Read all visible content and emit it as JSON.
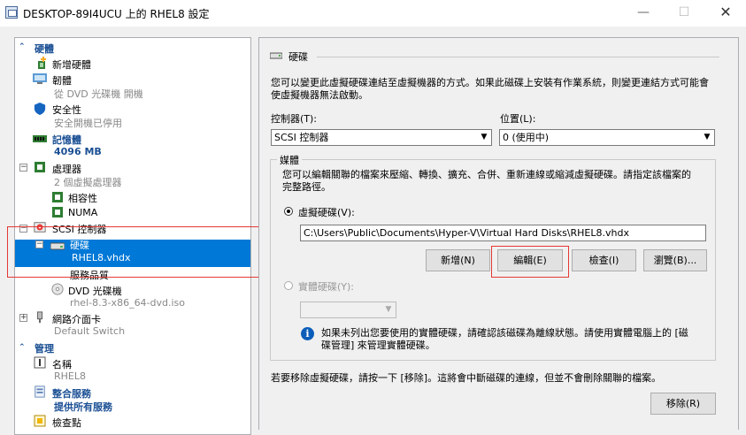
{
  "window": {
    "title": "DESKTOP-89I4UCU 上的 RHEL8 設定",
    "min_glyph": "—",
    "max_glyph": "☐",
    "close_glyph": "✕"
  },
  "tree": {
    "hardware_header": "硬體",
    "add_hardware": "新增硬體",
    "firmware": "韌體",
    "firmware_sub": "從 DVD 光碟機 開機",
    "security": "安全性",
    "security_sub": "安全開機已停用",
    "memory": "記憶體",
    "memory_sub": "4096 MB",
    "processor": "處理器",
    "processor_sub": "2 個虛擬處理器",
    "compatibility": "相容性",
    "numa": "NUMA",
    "scsi": "SCSI 控制器",
    "hard_drive": "硬碟",
    "hard_drive_sub": "RHEL8.vhdx",
    "qos": "服務品質",
    "dvd": "DVD 光碟機",
    "dvd_sub": "rhel-8.3-x86_64-dvd.iso",
    "nic": "網路介面卡",
    "nic_sub": "Default Switch",
    "management_header": "管理",
    "name": "名稱",
    "name_sub": "RHEL8",
    "integration": "整合服務",
    "integration_sub": "提供所有服務",
    "checkpoint": "檢查點"
  },
  "panel": {
    "title": "硬碟",
    "description": "您可以變更此虛擬硬碟連結至虛擬機器的方式。如果此磁碟上安裝有作業系統，則變更連結方式可能會使虛擬機器無法啟動。",
    "controller_label": "控制器(T):",
    "controller_value": "SCSI 控制器",
    "location_label": "位置(L):",
    "location_value": "0 (使用中)",
    "media_label": "媒體",
    "media_description": "您可以編輯關聯的檔案來壓縮、轉換、擴充、合併、重新連線或縮減虛擬硬碟。請指定該檔案的完整路徑。",
    "virtual_disk_label": "虛擬硬碟(V):",
    "virtual_disk_path": "C:\\Users\\Public\\Documents\\Hyper-V\\Virtual Hard Disks\\RHEL8.vhdx",
    "btn_new": "新增(N)",
    "btn_edit": "編輯(E)",
    "btn_inspect": "檢查(I)",
    "btn_browse": "瀏覽(B)...",
    "physical_disk_label": "實體硬碟(Y):",
    "info_text": "如果未列出您要使用的實體硬碟，請確認該磁碟為離線狀態。請使用實體電腦上的 [磁碟管理] 來管理實體硬碟。",
    "remove_text": "若要移除虛擬硬碟，請按一下 [移除]。這將會中斷磁碟的連線，但並不會刪除關聯的檔案。",
    "btn_remove": "移除(R)"
  },
  "colors": {
    "selection": "#0078d7",
    "header_blue": "#1a4f94",
    "highlight_box": "#e53935"
  }
}
